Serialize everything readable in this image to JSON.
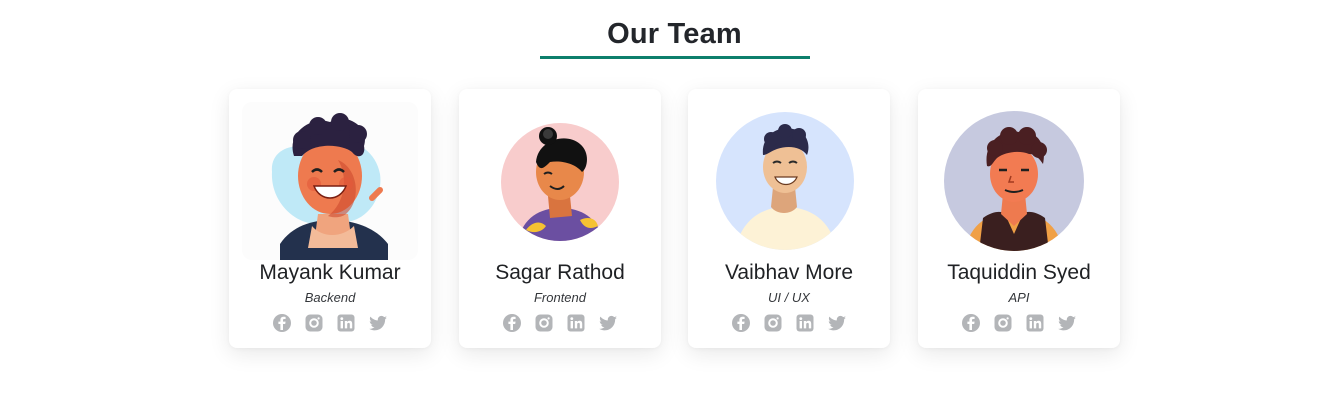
{
  "section": {
    "title": "Our Team"
  },
  "team": [
    {
      "name": "Mayank Kumar",
      "role": "Backend",
      "socials": [
        "facebook-icon",
        "instagram-icon",
        "linkedin-icon",
        "twitter-icon"
      ]
    },
    {
      "name": "Sagar Rathod",
      "role": "Frontend",
      "socials": [
        "facebook-icon",
        "instagram-icon",
        "linkedin-icon",
        "twitter-icon"
      ]
    },
    {
      "name": "Vaibhav More",
      "role": "UI / UX",
      "socials": [
        "facebook-icon",
        "instagram-icon",
        "linkedin-icon",
        "twitter-icon"
      ]
    },
    {
      "name": "Taquiddin Syed",
      "role": "API",
      "socials": [
        "facebook-icon",
        "instagram-icon",
        "linkedin-icon",
        "twitter-icon"
      ]
    }
  ],
  "colors": {
    "accent_underline": "#0d7f6c",
    "heading_text": "#23262b",
    "social_icon": "#b3b5b8",
    "avatar_bg_1": "#bfe9f7",
    "avatar_bg_2": "#f8cccc",
    "avatar_bg_3": "#d6e4fd",
    "avatar_bg_4": "#c6c9df"
  }
}
